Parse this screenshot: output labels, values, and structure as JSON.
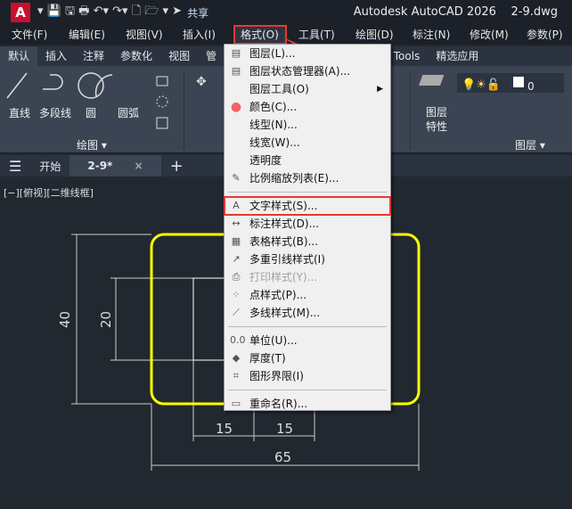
{
  "title": {
    "app": "Autodesk AutoCAD 2026",
    "file": "2-9.dwg",
    "logo": "A",
    "share": "共享"
  },
  "menubar": [
    "文件(F)",
    "编辑(E)",
    "视图(V)",
    "插入(I)",
    "格式(O)",
    "工具(T)",
    "绘图(D)",
    "标注(N)",
    "修改(M)",
    "参数(P)"
  ],
  "ribbon_tabs": [
    "默认",
    "插入",
    "注释",
    "参数化",
    "视图",
    "管",
    "Express Tools",
    "精选应用"
  ],
  "ribbon": {
    "line": "直线",
    "polyline": "多段线",
    "circle": "圆",
    "arc": "圆弧",
    "draw_panel": "绘图 ▾",
    "layer_props": "图层\n特性",
    "layer_panel": "图层 ▾",
    "layer_value": "0"
  },
  "doc_tabs": {
    "start": "开始",
    "current": "2-9*",
    "close": "×",
    "add": "+"
  },
  "viewport_label": "[−][俯视][二维线框]",
  "format_menu": [
    {
      "label": "图层(L)...",
      "icon": "layer-icon"
    },
    {
      "label": "图层状态管理器(A)...",
      "icon": "layer-state-icon"
    },
    {
      "label": "图层工具(O)",
      "icon": "",
      "submenu": true
    },
    {
      "label": "颜色(C)...",
      "icon": "color-wheel-icon"
    },
    {
      "label": "线型(N)...",
      "icon": ""
    },
    {
      "label": "线宽(W)...",
      "icon": ""
    },
    {
      "label": "透明度",
      "icon": ""
    },
    {
      "label": "比例缩放列表(E)...",
      "icon": "scale-list-icon"
    },
    {
      "label": "文字样式(S)...",
      "icon": "text-style-icon",
      "highlight": true
    },
    {
      "label": "标注样式(D)...",
      "icon": "dim-style-icon"
    },
    {
      "label": "表格样式(B)...",
      "icon": "table-style-icon"
    },
    {
      "label": "多重引线样式(I)",
      "icon": "mleader-style-icon"
    },
    {
      "label": "打印样式(Y)...",
      "icon": "plot-style-icon",
      "disabled": true
    },
    {
      "label": "点样式(P)...",
      "icon": "point-style-icon"
    },
    {
      "label": "多线样式(M)...",
      "icon": "mline-style-icon"
    },
    {
      "label": "单位(U)...",
      "icon": "units-icon"
    },
    {
      "label": "厚度(T)",
      "icon": "thickness-icon"
    },
    {
      "label": "图形界限(I)",
      "icon": "limits-icon"
    },
    {
      "label": "重命名(R)...",
      "icon": "rename-icon"
    }
  ],
  "dimensions": {
    "d40": "40",
    "d20": "20",
    "d15a": "15",
    "d15b": "15",
    "d65": "65"
  }
}
